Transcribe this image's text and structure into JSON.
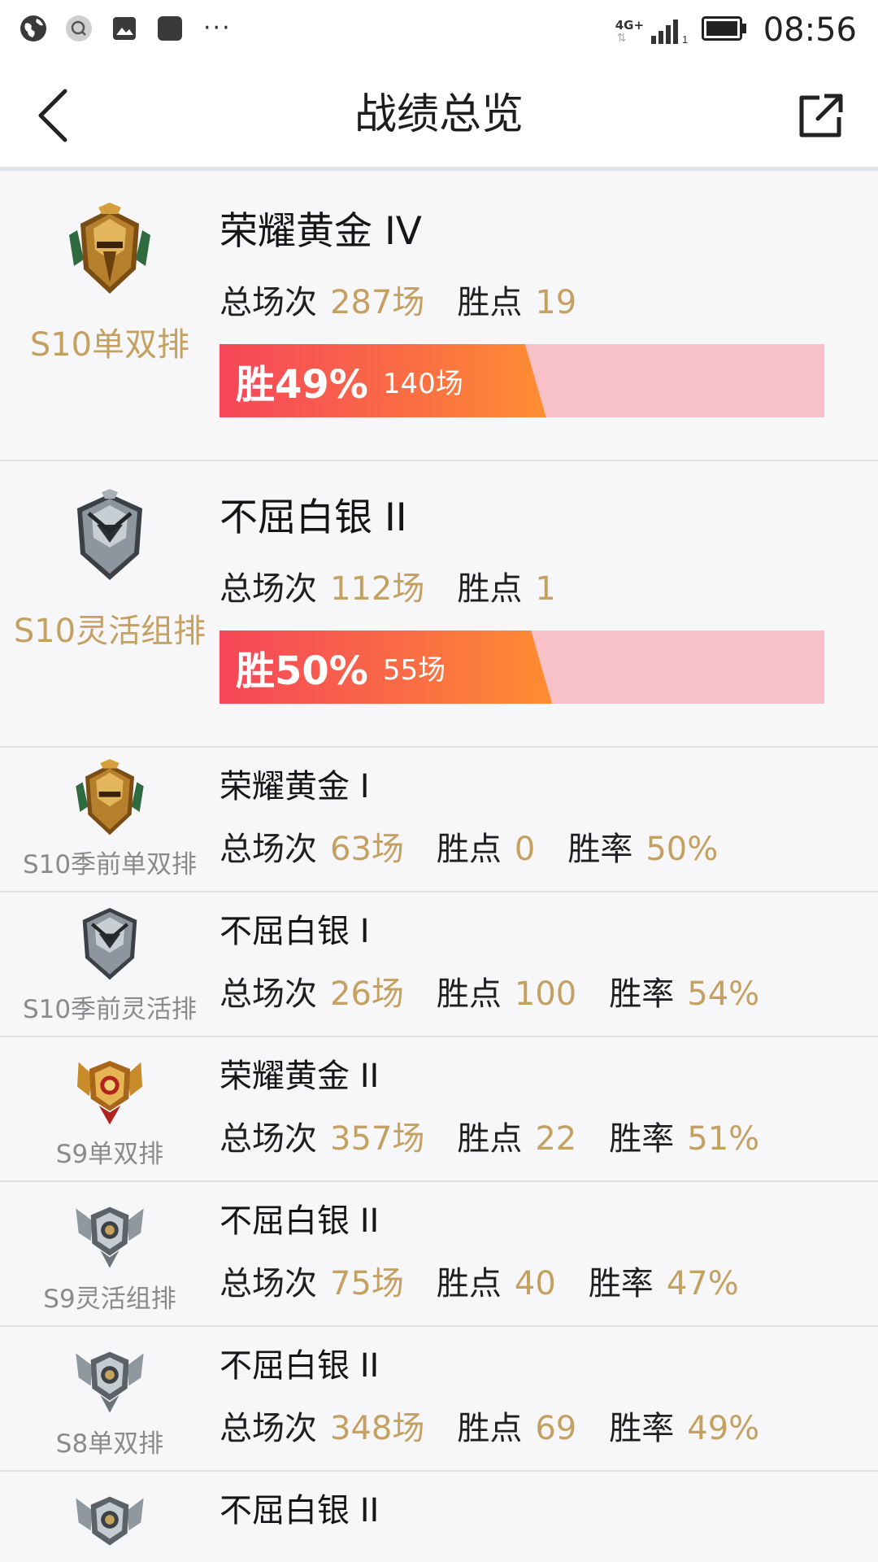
{
  "status_bar": {
    "network": "4G+",
    "sim": "1",
    "time": "08:56"
  },
  "header": {
    "title": "战绩总览"
  },
  "icons": {
    "back": "chevron-left-icon",
    "share": "share-external-icon"
  },
  "colors": {
    "accent_gold": "#c4a061",
    "win_gradient_start": "#f5465a",
    "win_gradient_end": "#fe8e32",
    "bar_track": "#f7c1c7"
  },
  "ranks": [
    {
      "queue": "S10单双排",
      "rank": "荣耀黄金 IV",
      "tier": "gold",
      "total_label": "总场次",
      "total_value": "287场",
      "lp_label": "胜点",
      "lp_value": "19",
      "win_rate_text": "胜49%",
      "win_rate": 0.49,
      "wins_text": "140场"
    },
    {
      "queue": "S10灵活组排",
      "rank": "不屈白银 II",
      "tier": "silver",
      "total_label": "总场次",
      "total_value": "112场",
      "lp_label": "胜点",
      "lp_value": "1",
      "win_rate_text": "胜50%",
      "win_rate": 0.5,
      "wins_text": "55场"
    },
    {
      "queue": "S10季前单双排",
      "rank": "荣耀黄金 I",
      "tier": "gold",
      "total_label": "总场次",
      "total_value": "63场",
      "lp_label": "胜点",
      "lp_value": "0",
      "rate_label": "胜率",
      "rate_value": "50%"
    },
    {
      "queue": "S10季前灵活排",
      "rank": "不屈白银 I",
      "tier": "silver",
      "total_label": "总场次",
      "total_value": "26场",
      "lp_label": "胜点",
      "lp_value": "100",
      "rate_label": "胜率",
      "rate_value": "54%"
    },
    {
      "queue": "S9单双排",
      "rank": "荣耀黄金 II",
      "tier": "gold-s9",
      "total_label": "总场次",
      "total_value": "357场",
      "lp_label": "胜点",
      "lp_value": "22",
      "rate_label": "胜率",
      "rate_value": "51%"
    },
    {
      "queue": "S9灵活组排",
      "rank": "不屈白银 II",
      "tier": "silver-s9",
      "total_label": "总场次",
      "total_value": "75场",
      "lp_label": "胜点",
      "lp_value": "40",
      "rate_label": "胜率",
      "rate_value": "47%"
    },
    {
      "queue": "S8单双排",
      "rank": "不屈白银 II",
      "tier": "silver-s9",
      "total_label": "总场次",
      "total_value": "348场",
      "lp_label": "胜点",
      "lp_value": "69",
      "rate_label": "胜率",
      "rate_value": "49%"
    },
    {
      "rank": "不屈白银 II",
      "tier": "silver-s9"
    }
  ]
}
